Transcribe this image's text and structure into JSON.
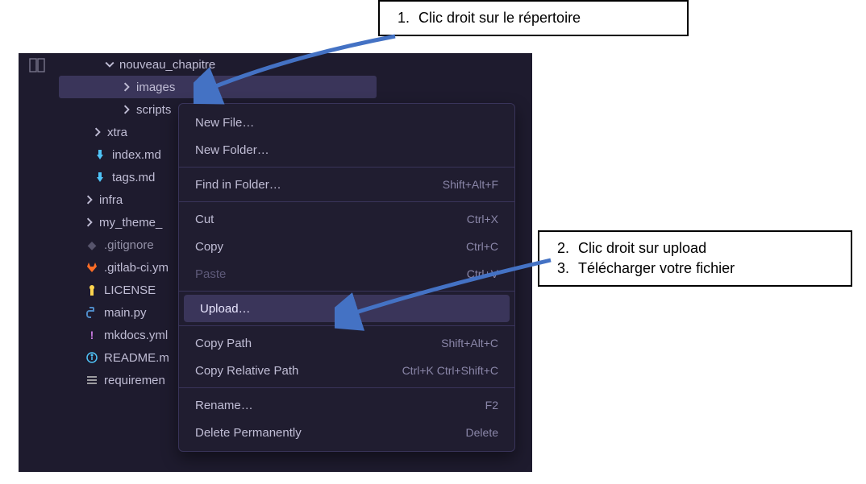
{
  "annotations": {
    "a1": "Clic droit sur le répertoire",
    "a2": "Clic droit sur upload",
    "a3": "Télécharger votre fichier"
  },
  "tree": {
    "nouveau_chapitre": "nouveau_chapitre",
    "images": "images",
    "scripts": "scripts",
    "xtra": "xtra",
    "index_md": "index.md",
    "tags_md": "tags.md",
    "infra": "infra",
    "my_theme": "my_theme_",
    "gitignore": ".gitignore",
    "gitlab_ci": ".gitlab-ci.ym",
    "license": "LICENSE",
    "main_py": "main.py",
    "mkdocs_yml": "mkdocs.yml",
    "readme": "README.m",
    "requirements": "requiremen"
  },
  "menu": {
    "new_file": {
      "label": "New File…",
      "shortcut": ""
    },
    "new_folder": {
      "label": "New Folder…",
      "shortcut": ""
    },
    "find_folder": {
      "label": "Find in Folder…",
      "shortcut": "Shift+Alt+F"
    },
    "cut": {
      "label": "Cut",
      "shortcut": "Ctrl+X"
    },
    "copy": {
      "label": "Copy",
      "shortcut": "Ctrl+C"
    },
    "paste": {
      "label": "Paste",
      "shortcut": "Ctrl+V"
    },
    "upload": {
      "label": "Upload…",
      "shortcut": ""
    },
    "copy_path": {
      "label": "Copy Path",
      "shortcut": "Shift+Alt+C"
    },
    "copy_rel": {
      "label": "Copy Relative Path",
      "shortcut": "Ctrl+K Ctrl+Shift+C"
    },
    "rename": {
      "label": "Rename…",
      "shortcut": "F2"
    },
    "delete": {
      "label": "Delete Permanently",
      "shortcut": "Delete"
    }
  }
}
